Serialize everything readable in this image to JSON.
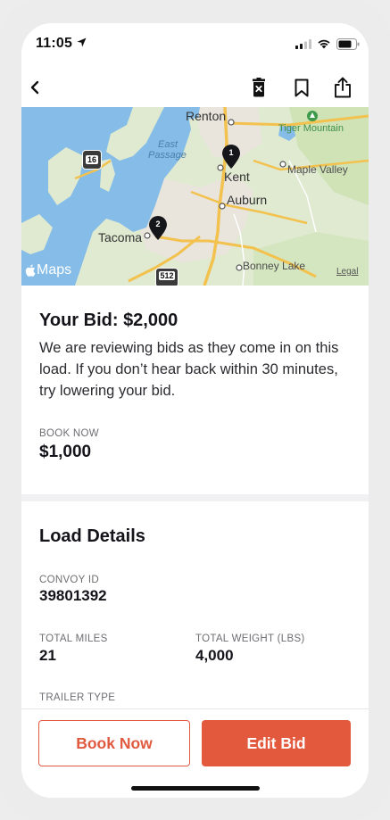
{
  "status": {
    "time": "11:05"
  },
  "nav": {
    "back_icon": "chevron-left-icon",
    "discard_icon": "trash-x-icon",
    "bookmark_icon": "bookmark-icon",
    "share_icon": "share-icon"
  },
  "map": {
    "labels": {
      "renton": "Renton",
      "tiger_mountain": "Tiger Mountain",
      "east_passage_1": "East",
      "east_passage_2": "Passage",
      "kent": "Kent",
      "maple_valley": "Maple Valley",
      "auburn": "Auburn",
      "tacoma": "Tacoma",
      "bonney_lake": "Bonney Lake",
      "route_16": "16",
      "route_512": "512"
    },
    "pins": [
      "1",
      "2"
    ],
    "brand": "Maps",
    "legal": "Legal"
  },
  "bid": {
    "title": "Your Bid: $2,000",
    "description": "We are reviewing bids as they come in on this load. If you don’t hear back within 30 minutes, try lowering your bid.",
    "book_now_label": "BOOK NOW",
    "book_now_value": "$1,000"
  },
  "details": {
    "title": "Load Details",
    "convoy_id_label": "CONVOY ID",
    "convoy_id_value": "39801392",
    "total_miles_label": "TOTAL MILES",
    "total_miles_value": "21",
    "total_weight_label": "TOTAL WEIGHT (LBS)",
    "total_weight_value": "4,000",
    "trailer_type_label": "TRAILER TYPE"
  },
  "actions": {
    "book_now": "Book Now",
    "edit_bid": "Edit Bid"
  },
  "colors": {
    "accent": "#e3593d",
    "water": "#7fb6e3",
    "land": "#dfead0",
    "road": "#f2c14e"
  }
}
